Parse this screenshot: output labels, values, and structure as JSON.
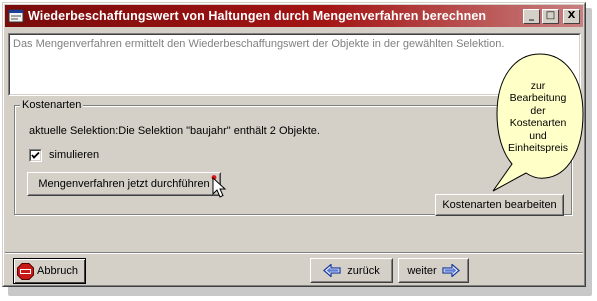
{
  "window": {
    "title": "Wiederbeschaffungswert von Haltungen durch Mengenverfahren berechnen",
    "minimize_label": "_",
    "maximize_label": "□",
    "close_label": "X"
  },
  "description": "Das Mengenverfahren ermittelt den Wiederbeschaffungswert der Objekte in der gewählten Selektion.",
  "group": {
    "label": "Kostenarten",
    "selection_text": "aktuelle Selektion:Die Selektion \"baujahr\" enthält 2 Objekte.",
    "simulate_label": "simulieren",
    "simulate_checked": true,
    "run_button_label": "Mengenverfahren jetzt durchführen",
    "edit_button_label": "Kostenarten bearbeiten"
  },
  "callout": {
    "text_lines": [
      "zur",
      "Bearbeitung",
      "der",
      "Kostenarten",
      "und",
      "Einheitspreis"
    ]
  },
  "footer": {
    "cancel_label": "Abbruch",
    "cancel_icon": "stop-sign-icon",
    "back_label": "zurück",
    "back_icon": "arrow-left-icon",
    "next_label": "weiter",
    "next_icon": "arrow-right-icon"
  },
  "colors": {
    "titlebar_start": "#7a0c0c",
    "titlebar_end": "#c98080",
    "callout_fill": "#ffffc8",
    "dialog_bg": "#d4d0c8"
  }
}
